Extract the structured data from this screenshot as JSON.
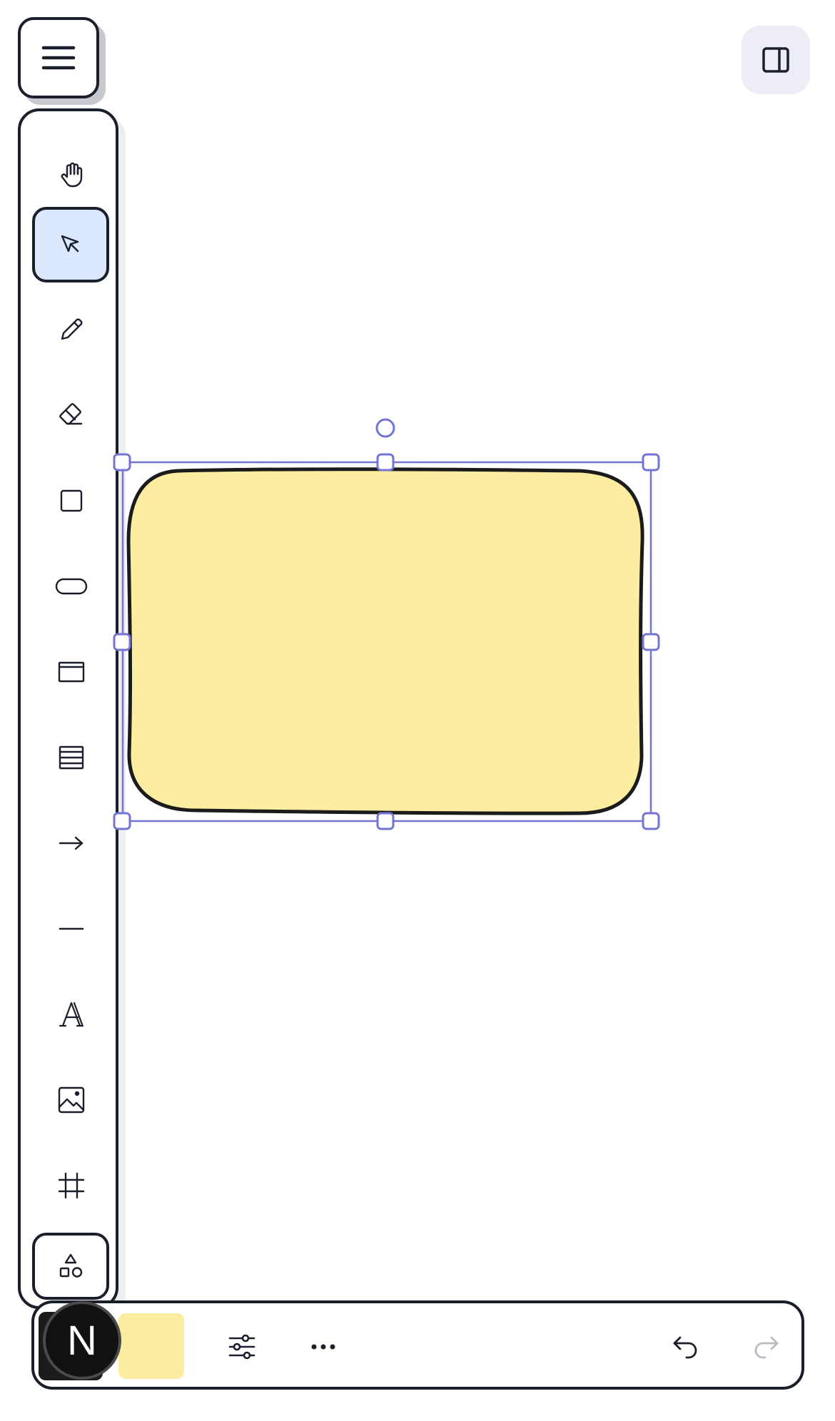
{
  "app": {
    "menu_icon": "hamburger-icon",
    "sidebar_toggle_icon": "panel-right-icon"
  },
  "tools": [
    {
      "id": "hand",
      "icon": "hand-icon",
      "active": false
    },
    {
      "id": "select",
      "icon": "cursor-arrow-icon",
      "active": true
    },
    {
      "id": "pencil",
      "icon": "pencil-icon",
      "active": false
    },
    {
      "id": "eraser",
      "icon": "eraser-icon",
      "active": false
    },
    {
      "id": "rectangle",
      "icon": "square-icon",
      "active": false
    },
    {
      "id": "ellipse",
      "icon": "pill-icon",
      "active": false
    },
    {
      "id": "browser",
      "icon": "browser-window-icon",
      "active": false
    },
    {
      "id": "table",
      "icon": "table-icon",
      "active": false
    },
    {
      "id": "arrow",
      "icon": "arrow-right-icon",
      "active": false
    },
    {
      "id": "line",
      "icon": "line-icon",
      "active": false
    },
    {
      "id": "text",
      "icon": "text-icon",
      "active": false
    },
    {
      "id": "image",
      "icon": "image-icon",
      "active": false
    },
    {
      "id": "frame",
      "icon": "frame-icon",
      "active": false
    },
    {
      "id": "shapes",
      "icon": "shapes-icon",
      "active": false
    }
  ],
  "canvas": {
    "shape": {
      "type": "rounded-rectangle",
      "fill": "#fdeda0",
      "stroke": "#1b1b1b",
      "selected": true
    },
    "selection_color": "#7474d2"
  },
  "bottom_bar": {
    "badge_letter": "N",
    "stroke_color": "#1b1b1b",
    "fill_color": "#fdeda0",
    "style_icon": "sliders-icon",
    "more_icon": "ellipsis-icon",
    "undo_icon": "undo-icon",
    "redo_icon": "redo-icon",
    "redo_enabled": false
  }
}
